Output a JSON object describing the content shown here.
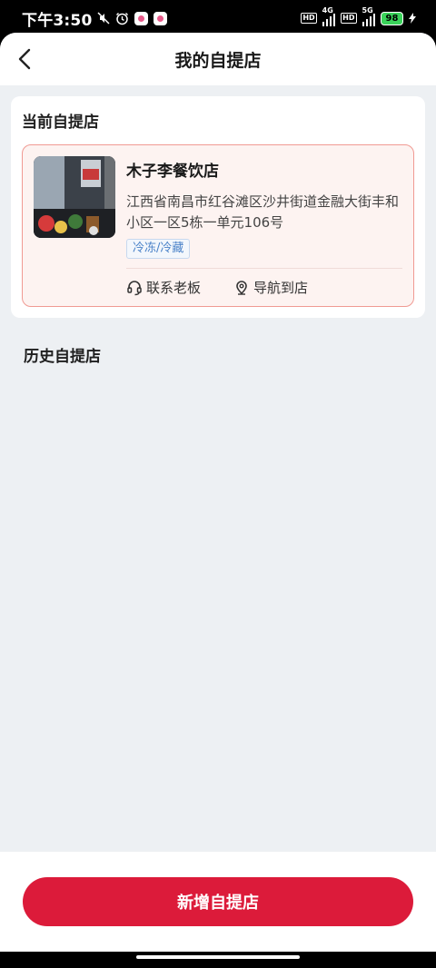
{
  "status_bar": {
    "time": "下午3:50",
    "net1": "4G",
    "net2": "5G",
    "hd1": "HD",
    "hd2": "HD",
    "battery": "98"
  },
  "header": {
    "title": "我的自提店",
    "back_icon": "chevron-left-icon"
  },
  "current_section": {
    "title": "当前自提店",
    "store": {
      "name": "木子李餐饮店",
      "address": "江西省南昌市红谷滩区沙井街道金融大街丰和小区一区5栋一单元106号",
      "tag": "冷冻/冷藏",
      "actions": {
        "contact_label": "联系老板",
        "navigate_label": "导航到店"
      }
    }
  },
  "history_section": {
    "title": "历史自提店"
  },
  "bottom": {
    "add_button_label": "新增自提店"
  },
  "colors": {
    "accent": "#dc1b3a",
    "card_border": "#f09a93",
    "tag_text": "#4a82c8",
    "page_bg": "#edf0f3"
  }
}
